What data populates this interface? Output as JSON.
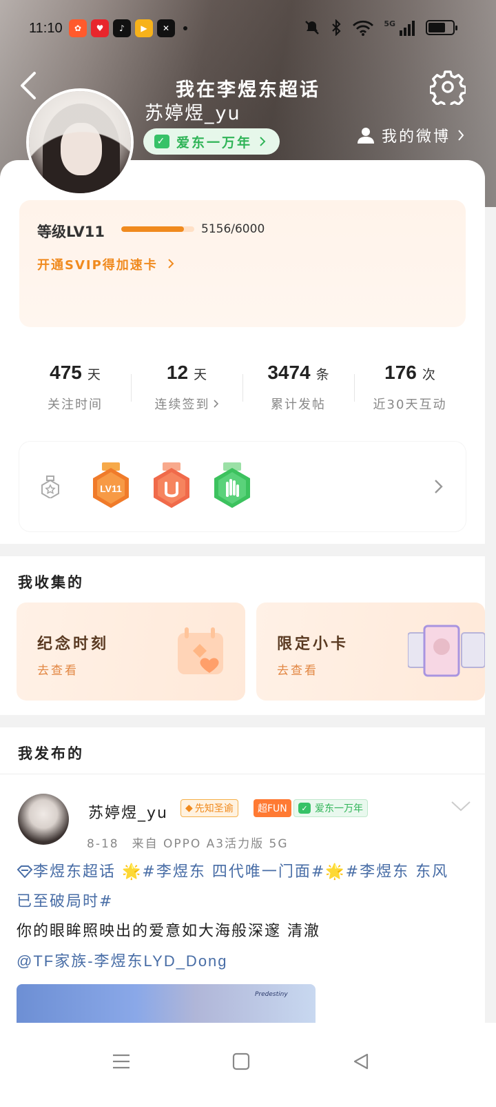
{
  "status_bar": {
    "time": "11:10",
    "network": "5G",
    "icons": [
      "notifications-muted-icon",
      "bluetooth-icon",
      "wifi-icon",
      "signal-icon",
      "battery-icon"
    ]
  },
  "header": {
    "title": "我在李煜东超话",
    "username": "苏婷煜_yu",
    "fan_badge": "爱东一万年",
    "my_weibo": "我的微博"
  },
  "level": {
    "label": "等级LV11",
    "progress": 5156,
    "max": 6000,
    "value_text": "5156/6000",
    "svip_link": "开通SVIP得加速卡"
  },
  "stats": [
    {
      "num": "475",
      "unit": "天",
      "label": "关注时间",
      "link": false
    },
    {
      "num": "12",
      "unit": "天",
      "label": "连续签到",
      "link": true
    },
    {
      "num": "3474",
      "unit": "条",
      "label": "累计发帖",
      "link": false
    },
    {
      "num": "176",
      "unit": "次",
      "label": "近30天互动",
      "link": false
    }
  ],
  "medals": {
    "badge_text": "LV11"
  },
  "collected": {
    "title": "我收集的",
    "cards": [
      {
        "title": "纪念时刻",
        "sub": "去查看"
      },
      {
        "title": "限定小卡",
        "sub": "去查看"
      }
    ]
  },
  "posted": {
    "title": "我发布的"
  },
  "post": {
    "user": "苏婷煜_yu",
    "tag_xianzhi": "先知圣谕",
    "tag_fun": "超FUN",
    "tag_fan": "爱东一万年",
    "meta": "8-18　来自 OPPO A3活力版 5G",
    "line1": "李煜东超话 🌟#李煜东 四代唯一门面#🌟#李煜东 东风已至破局时#",
    "line2": "你的眼眸照映出的爱意如大海般深邃 清澈",
    "line3": "@TF家族-李煜东LYD_Dong",
    "image_caption": "Predestiny"
  },
  "colors": {
    "accent_orange": "#f08a1e",
    "fan_green": "#2fb457",
    "link_blue": "#486da6"
  }
}
